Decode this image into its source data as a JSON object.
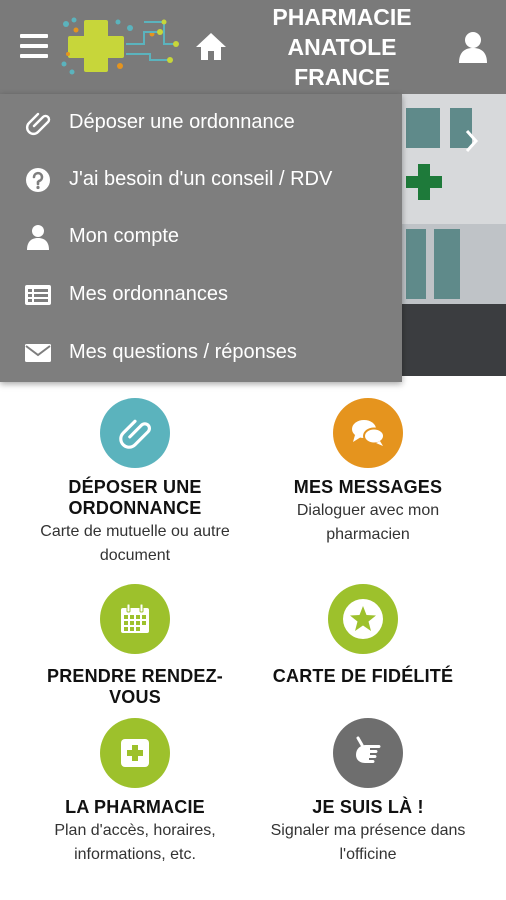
{
  "header": {
    "title_lines": [
      "PHARMACIE",
      "ANATOLE",
      "FRANCE"
    ]
  },
  "menu": {
    "items": [
      {
        "label": "Déposer une ordonnance",
        "icon": "paperclip-icon"
      },
      {
        "label": "J'ai besoin d'un conseil / RDV",
        "icon": "question-icon"
      },
      {
        "label": "Mon compte",
        "icon": "user-icon"
      },
      {
        "label": "Mes ordonnances",
        "icon": "list-card-icon"
      },
      {
        "label": "Mes questions / réponses",
        "icon": "envelope-icon"
      }
    ]
  },
  "tiles": [
    {
      "title_lines": [
        "DÉPOSER UNE",
        "ORDONNANCE"
      ],
      "subtitle_lines": [
        "Carte de mutuelle ou autre",
        "document"
      ],
      "icon": "paperclip-icon",
      "color": "#5bb3bd"
    },
    {
      "title_lines": [
        "MES MESSAGES"
      ],
      "subtitle_lines": [
        "Dialoguer avec mon",
        "pharmacien"
      ],
      "icon": "chat-icon",
      "color": "#e5941e"
    },
    {
      "title_lines": [
        "PRENDRE RENDEZ-",
        "VOUS"
      ],
      "subtitle_lines": [],
      "icon": "calendar-icon",
      "color": "#9dc12c"
    },
    {
      "title_lines": [
        "CARTE DE FIDÉLITÉ"
      ],
      "subtitle_lines": [],
      "icon": "star-icon",
      "color": "#9dc12c"
    },
    {
      "title_lines": [
        "LA PHARMACIE"
      ],
      "subtitle_lines": [
        "Plan d'accès, horaires,",
        "informations, etc."
      ],
      "icon": "plus-square-icon",
      "color": "#9dc12c"
    },
    {
      "title_lines": [
        "JE SUIS LÀ !"
      ],
      "subtitle_lines": [
        "Signaler ma présence dans",
        "l'officine"
      ],
      "icon": "hand-icon",
      "color": "#6e6e6e"
    }
  ],
  "colors": {
    "header_bg": "#7a7a7a",
    "drawer_bg": "#7e7e7e",
    "teal": "#5bb3bd",
    "orange": "#e5941e",
    "green": "#9dc12c",
    "grey": "#6e6e6e"
  }
}
